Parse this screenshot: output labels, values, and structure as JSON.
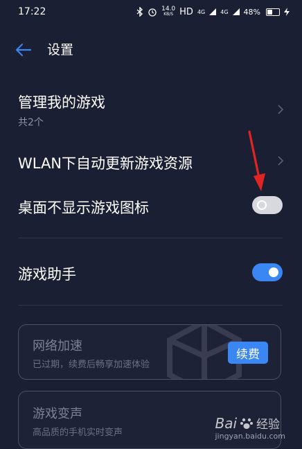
{
  "status_bar": {
    "time": "17:22",
    "net_speed": "14.0",
    "net_unit": "KB/S",
    "hd": "HD",
    "signal_1": "4G",
    "signal_2": "4G",
    "battery": "48%"
  },
  "header": {
    "title": "设置"
  },
  "settings": {
    "manage_games": {
      "label": "管理我的游戏",
      "sub": "共2个"
    },
    "wlan_update": {
      "label": "WLAN下自动更新游戏资源"
    },
    "hide_icon": {
      "label": "桌面不显示游戏图标",
      "toggle_on": false
    },
    "game_assistant": {
      "label": "游戏助手",
      "toggle_on": true
    }
  },
  "cards": {
    "network_boost": {
      "title": "网络加速",
      "sub": "已过期，续费后畅享加速体验",
      "button_label": "续费"
    },
    "voice_changer": {
      "title": "游戏变声",
      "sub": "高品质的手机实时变声"
    }
  },
  "watermark": {
    "brand": "Bai",
    "brand_suffix": "经验",
    "url": "jingyan.baidu.com"
  },
  "colors": {
    "background": "#1b1f33",
    "accent": "#3a86f2",
    "annotation_arrow": "#e02424"
  },
  "icons": [
    "back-arrow-icon",
    "chevron-right-icon",
    "bluetooth-icon",
    "alarm-icon",
    "battery-icon",
    "paw-icon"
  ]
}
